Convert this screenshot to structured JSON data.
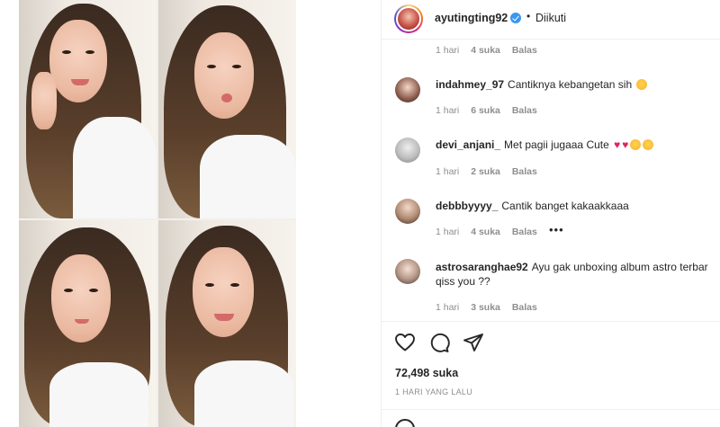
{
  "post": {
    "author": "ayutingting92",
    "verified": true,
    "separator": "•",
    "follow_status": "Diikuti",
    "likes_text": "72,498 suka",
    "posted_text": "1 HARI YANG LALU"
  },
  "first_meta": {
    "time": "1 hari",
    "likes": "4 suka",
    "reply": "Balas"
  },
  "comments": [
    {
      "user": "indahmey_97",
      "text": "Cantiknya kebangetan sih",
      "emoji": [
        "smiling-face-heart-eyes"
      ],
      "time": "1 hari",
      "likes": "6 suka",
      "reply": "Balas"
    },
    {
      "user": "devi_anjani_",
      "text": "Met pagii jugaaa Cute",
      "emoji": [
        "red-heart",
        "red-heart",
        "face-savoring",
        "face-savoring"
      ],
      "time": "1 hari",
      "likes": "2 suka",
      "reply": "Balas"
    },
    {
      "user": "debbbyyyy_",
      "text": "Cantik banget kakaakkaaa",
      "emoji": [],
      "time": "1 hari",
      "likes": "4 suka",
      "reply": "Balas",
      "more": "•••"
    },
    {
      "user": "astrosaranghae92",
      "text": "Ayu gak unboxing album astro terbar",
      "text2": "qiss you ??",
      "emoji": [],
      "time": "1 hari",
      "likes": "3 suka",
      "reply": "Balas"
    }
  ],
  "icons": [
    "heart-icon",
    "comment-icon",
    "share-icon",
    "emoji-icon"
  ],
  "colors": {
    "accent": "#3897f0",
    "muted": "#8e8e8e",
    "text": "#262626",
    "heart": "#e0245e"
  }
}
